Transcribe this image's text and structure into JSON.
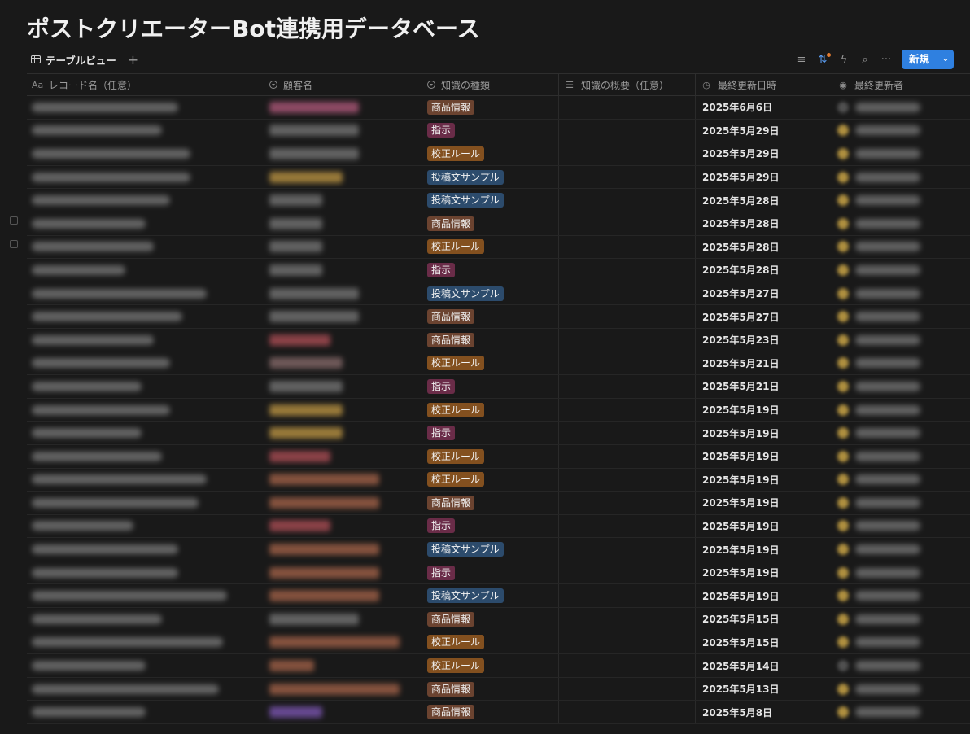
{
  "page": {
    "title": "ポストクリエーターBot連携用データベース"
  },
  "view": {
    "label": "テーブルビュー",
    "add_icon": "plus-icon"
  },
  "toolbar": {
    "icons": [
      "filter-icon",
      "sort-icon",
      "automation-icon",
      "search-icon",
      "more-icon"
    ],
    "new_button_label": "新規",
    "new_button_color": "#2f80e0"
  },
  "columns": [
    {
      "label": "レコード名（任意）",
      "icon": "Aa"
    },
    {
      "label": "顧客名",
      "icon": "select-icon"
    },
    {
      "label": "知識の種類",
      "icon": "select-icon"
    },
    {
      "label": "知識の概要（任意）",
      "icon": "text-lines-icon"
    },
    {
      "label": "最終更新日時",
      "icon": "clock-icon"
    },
    {
      "label": "最終更新者",
      "icon": "person-icon"
    }
  ],
  "tag_colors": {
    "商品情報": "#6b4330",
    "指示": "#6a2c48",
    "校正ルール": "#83501f",
    "投稿文サンプル": "#2c4b6c"
  },
  "rows": [
    {
      "type": "商品情報",
      "date": "2025年6月6日"
    },
    {
      "type": "指示",
      "date": "2025年5月29日"
    },
    {
      "type": "校正ルール",
      "date": "2025年5月29日"
    },
    {
      "type": "投稿文サンプル",
      "date": "2025年5月29日"
    },
    {
      "type": "投稿文サンプル",
      "date": "2025年5月28日"
    },
    {
      "type": "商品情報",
      "date": "2025年5月28日"
    },
    {
      "type": "校正ルール",
      "date": "2025年5月28日"
    },
    {
      "type": "指示",
      "date": "2025年5月28日"
    },
    {
      "type": "投稿文サンプル",
      "date": "2025年5月27日"
    },
    {
      "type": "商品情報",
      "date": "2025年5月27日"
    },
    {
      "type": "商品情報",
      "date": "2025年5月23日"
    },
    {
      "type": "校正ルール",
      "date": "2025年5月21日"
    },
    {
      "type": "指示",
      "date": "2025年5月21日"
    },
    {
      "type": "校正ルール",
      "date": "2025年5月19日"
    },
    {
      "type": "指示",
      "date": "2025年5月19日"
    },
    {
      "type": "校正ルール",
      "date": "2025年5月19日"
    },
    {
      "type": "校正ルール",
      "date": "2025年5月19日"
    },
    {
      "type": "商品情報",
      "date": "2025年5月19日"
    },
    {
      "type": "指示",
      "date": "2025年5月19日"
    },
    {
      "type": "投稿文サンプル",
      "date": "2025年5月19日"
    },
    {
      "type": "指示",
      "date": "2025年5月19日"
    },
    {
      "type": "投稿文サンプル",
      "date": "2025年5月19日"
    },
    {
      "type": "商品情報",
      "date": "2025年5月15日"
    },
    {
      "type": "校正ルール",
      "date": "2025年5月15日"
    },
    {
      "type": "校正ルール",
      "date": "2025年5月14日"
    },
    {
      "type": "商品情報",
      "date": "2025年5月13日"
    },
    {
      "type": "商品情報",
      "date": "2025年5月8日"
    }
  ]
}
